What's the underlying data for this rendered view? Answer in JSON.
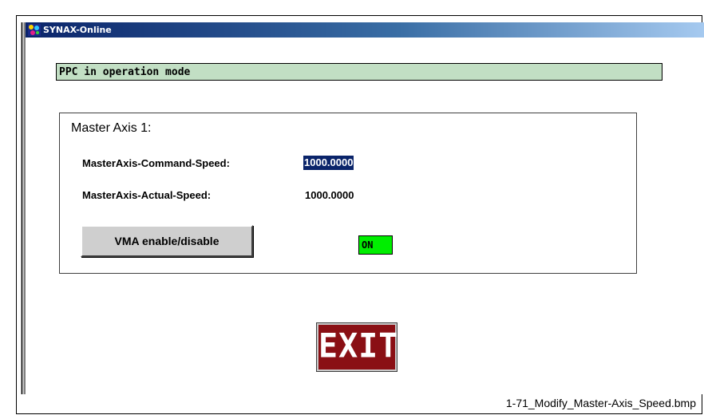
{
  "window": {
    "title": "SYNAX-Online",
    "app_icon": "synax-app-icon"
  },
  "status": {
    "text": "PPC in operation mode",
    "color": "#c2dfc4"
  },
  "master_axis": {
    "title": "Master Axis 1:",
    "command_speed": {
      "label": "MasterAxis-Command-Speed:",
      "value": "1000.0000"
    },
    "actual_speed": {
      "label": "MasterAxis-Actual-Speed:",
      "value": "1000.0000"
    },
    "vma_button_label": "VMA enable/disable",
    "vma_state": {
      "text": "ON",
      "color": "#00ee00"
    }
  },
  "exit_button": {
    "label": "EXIT",
    "color": "#8a0f14"
  },
  "caption": "1-71_Modify_Master-Axis_Speed.bmp"
}
